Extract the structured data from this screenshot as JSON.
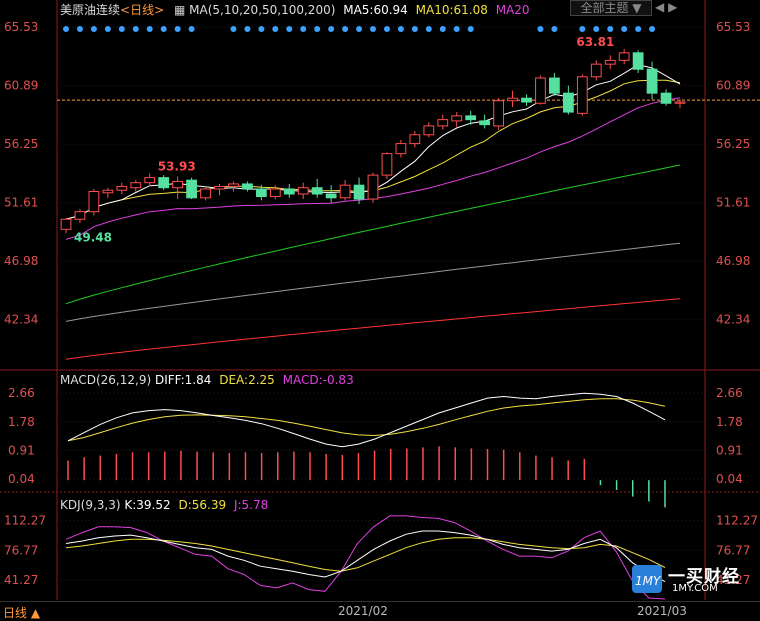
{
  "header": {
    "instrument": "美原油连续",
    "period_label": "<日线>",
    "ma_label": "MA(5,10,20,50,100,200)",
    "ma5_label": "MA5:60.94",
    "ma10_label": "MA10:61.08",
    "ma20_label": "MA20",
    "theme_button": "全部主题 ▼"
  },
  "macd_header": {
    "label": "MACD(26,12,9)",
    "diff": "DIFF:1.84",
    "dea": "DEA:2.25",
    "macd": "MACD:-0.83"
  },
  "kdj_header": {
    "label": "KDJ(9,3,3)",
    "k": "K:39.52",
    "d": "D:56.39",
    "j": "J:5.78"
  },
  "bottom": {
    "period": "日线 ▲",
    "date1": "2021/02",
    "date2": "2021/03"
  },
  "logo": {
    "text": "一买财经",
    "url": "1MY.COM"
  },
  "colors": {
    "up": "#ff4d4d",
    "down": "#55e0a0",
    "ma5": "#ffffff",
    "ma10": "#f0e040",
    "ma20": "#e040e0",
    "ma50": "#22cc22",
    "ma100": "#999999",
    "ma200": "#ff3333",
    "axis_text": "#e05050",
    "marker": "#3da2ff"
  },
  "chart_data": [
    {
      "type": "candlestick",
      "title": "",
      "ylim": [
        38.5,
        66.5
      ],
      "yticks": [
        65.53,
        60.89,
        56.25,
        51.61,
        46.98,
        42.34
      ],
      "current_price_line": 59.75,
      "annotations": [
        {
          "text": "53.93",
          "index": 6,
          "value": 53.93
        },
        {
          "text": "49.48",
          "index": 0,
          "value": 49.48
        },
        {
          "text": "63.81",
          "index": 36,
          "value": 63.81
        }
      ],
      "candles": [
        {
          "o": 49.5,
          "h": 50.4,
          "l": 49.2,
          "c": 50.3
        },
        {
          "o": 50.3,
          "h": 51.1,
          "l": 50.0,
          "c": 50.9
        },
        {
          "o": 50.9,
          "h": 52.7,
          "l": 50.6,
          "c": 52.5
        },
        {
          "o": 52.4,
          "h": 52.8,
          "l": 52.0,
          "c": 52.6
        },
        {
          "o": 52.6,
          "h": 53.2,
          "l": 52.3,
          "c": 52.9
        },
        {
          "o": 52.8,
          "h": 53.4,
          "l": 52.5,
          "c": 53.2
        },
        {
          "o": 53.2,
          "h": 53.93,
          "l": 52.9,
          "c": 53.6
        },
        {
          "o": 53.6,
          "h": 53.8,
          "l": 52.6,
          "c": 52.8
        },
        {
          "o": 52.8,
          "h": 53.7,
          "l": 51.9,
          "c": 53.3
        },
        {
          "o": 53.4,
          "h": 53.6,
          "l": 51.9,
          "c": 52.0
        },
        {
          "o": 52.0,
          "h": 52.9,
          "l": 51.8,
          "c": 52.7
        },
        {
          "o": 52.7,
          "h": 53.1,
          "l": 52.2,
          "c": 52.9
        },
        {
          "o": 52.9,
          "h": 53.3,
          "l": 52.5,
          "c": 53.1
        },
        {
          "o": 53.1,
          "h": 53.3,
          "l": 52.5,
          "c": 52.7
        },
        {
          "o": 52.7,
          "h": 53.0,
          "l": 51.8,
          "c": 52.1
        },
        {
          "o": 52.1,
          "h": 53.0,
          "l": 51.9,
          "c": 52.7
        },
        {
          "o": 52.7,
          "h": 53.1,
          "l": 52.0,
          "c": 52.3
        },
        {
          "o": 52.3,
          "h": 53.2,
          "l": 51.9,
          "c": 52.8
        },
        {
          "o": 52.8,
          "h": 53.5,
          "l": 52.0,
          "c": 52.3
        },
        {
          "o": 52.3,
          "h": 53.0,
          "l": 51.6,
          "c": 52.0
        },
        {
          "o": 52.0,
          "h": 53.4,
          "l": 51.8,
          "c": 53.0
        },
        {
          "o": 53.0,
          "h": 53.6,
          "l": 51.5,
          "c": 51.9
        },
        {
          "o": 51.9,
          "h": 54.0,
          "l": 51.6,
          "c": 53.8
        },
        {
          "o": 53.8,
          "h": 55.6,
          "l": 53.5,
          "c": 55.5
        },
        {
          "o": 55.5,
          "h": 56.6,
          "l": 55.2,
          "c": 56.3
        },
        {
          "o": 56.3,
          "h": 57.3,
          "l": 56.0,
          "c": 57.0
        },
        {
          "o": 57.0,
          "h": 58.0,
          "l": 56.8,
          "c": 57.7
        },
        {
          "o": 57.7,
          "h": 58.6,
          "l": 57.4,
          "c": 58.2
        },
        {
          "o": 58.1,
          "h": 58.8,
          "l": 57.6,
          "c": 58.5
        },
        {
          "o": 58.5,
          "h": 58.9,
          "l": 57.8,
          "c": 58.2
        },
        {
          "o": 58.1,
          "h": 58.6,
          "l": 57.5,
          "c": 57.8
        },
        {
          "o": 57.7,
          "h": 59.9,
          "l": 57.4,
          "c": 59.7
        },
        {
          "o": 59.7,
          "h": 60.5,
          "l": 59.2,
          "c": 59.9
        },
        {
          "o": 59.9,
          "h": 60.2,
          "l": 59.3,
          "c": 59.6
        },
        {
          "o": 59.5,
          "h": 61.7,
          "l": 59.4,
          "c": 61.5
        },
        {
          "o": 61.5,
          "h": 61.9,
          "l": 60.1,
          "c": 60.3
        },
        {
          "o": 60.3,
          "h": 60.9,
          "l": 58.6,
          "c": 58.8
        },
        {
          "o": 58.7,
          "h": 61.8,
          "l": 58.5,
          "c": 61.6
        },
        {
          "o": 61.6,
          "h": 62.9,
          "l": 61.3,
          "c": 62.6
        },
        {
          "o": 62.6,
          "h": 63.3,
          "l": 62.2,
          "c": 62.9
        },
        {
          "o": 62.9,
          "h": 63.81,
          "l": 62.6,
          "c": 63.5
        },
        {
          "o": 63.5,
          "h": 63.7,
          "l": 61.9,
          "c": 62.2
        },
        {
          "o": 62.2,
          "h": 62.8,
          "l": 59.8,
          "c": 60.3
        },
        {
          "o": 60.3,
          "h": 60.6,
          "l": 59.3,
          "c": 59.5
        },
        {
          "o": 59.5,
          "h": 59.8,
          "l": 59.1,
          "c": 59.6
        }
      ],
      "ma": {
        "ma50": {
          "start": 43.6,
          "end": 54.6
        },
        "ma100": {
          "start": 42.2,
          "end": 48.4
        },
        "ma200": {
          "start": 39.2,
          "end": 44.0
        }
      }
    },
    {
      "type": "bar",
      "title": "MACD",
      "yticks": [
        2.66,
        1.78,
        0.91,
        0.04
      ],
      "ylim": [
        -0.3,
        2.9
      ],
      "diff": [
        1.2,
        1.45,
        1.7,
        1.9,
        2.05,
        2.12,
        2.15,
        2.12,
        2.05,
        1.97,
        1.9,
        1.82,
        1.72,
        1.58,
        1.42,
        1.25,
        1.1,
        1.02,
        1.1,
        1.25,
        1.45,
        1.65,
        1.85,
        2.05,
        2.2,
        2.35,
        2.5,
        2.55,
        2.5,
        2.48,
        2.55,
        2.6,
        2.65,
        2.62,
        2.55,
        2.35,
        2.1,
        1.84
      ],
      "dea": [
        1.2,
        1.3,
        1.45,
        1.6,
        1.74,
        1.85,
        1.93,
        1.98,
        1.99,
        1.98,
        1.96,
        1.93,
        1.88,
        1.82,
        1.74,
        1.64,
        1.54,
        1.44,
        1.38,
        1.36,
        1.4,
        1.48,
        1.58,
        1.7,
        1.84,
        1.97,
        2.1,
        2.2,
        2.26,
        2.3,
        2.35,
        2.4,
        2.45,
        2.48,
        2.48,
        2.44,
        2.36,
        2.25
      ],
      "macd": [
        0.05,
        0.15,
        0.2,
        0.25,
        0.3,
        0.3,
        0.32,
        0.35,
        0.32,
        0.3,
        0.28,
        0.3,
        0.28,
        0.3,
        0.32,
        0.3,
        0.25,
        0.22,
        0.28,
        0.35,
        0.4,
        0.42,
        0.45,
        0.48,
        0.45,
        0.42,
        0.4,
        0.38,
        0.3,
        0.2,
        0.15,
        0.05,
        0.1,
        -0.15,
        -0.3,
        -0.5,
        -0.65,
        -0.83
      ]
    },
    {
      "type": "line",
      "title": "KDJ",
      "yticks": [
        112.27,
        76.77,
        41.27
      ],
      "ylim": [
        20,
        125
      ],
      "k": [
        85,
        88,
        92,
        94,
        95,
        92,
        88,
        84,
        80,
        78,
        70,
        65,
        58,
        55,
        52,
        48,
        45,
        52,
        65,
        78,
        88,
        96,
        100,
        100,
        98,
        95,
        90,
        84,
        80,
        78,
        76,
        78,
        85,
        90,
        80,
        62,
        50,
        39.52
      ],
      "d": [
        80,
        82,
        85,
        88,
        90,
        90,
        89,
        87,
        85,
        82,
        78,
        74,
        70,
        66,
        62,
        58,
        54,
        52,
        56,
        64,
        72,
        80,
        86,
        90,
        92,
        92,
        90,
        87,
        84,
        82,
        80,
        79,
        80,
        84,
        82,
        74,
        66,
        56.39
      ],
      "j": [
        90,
        98,
        105,
        105,
        104,
        98,
        88,
        80,
        72,
        70,
        55,
        48,
        35,
        32,
        38,
        30,
        28,
        52,
        85,
        105,
        118,
        118,
        116,
        115,
        110,
        100,
        88,
        78,
        70,
        70,
        68,
        76,
        92,
        100,
        75,
        40,
        20,
        5.78
      ]
    }
  ]
}
